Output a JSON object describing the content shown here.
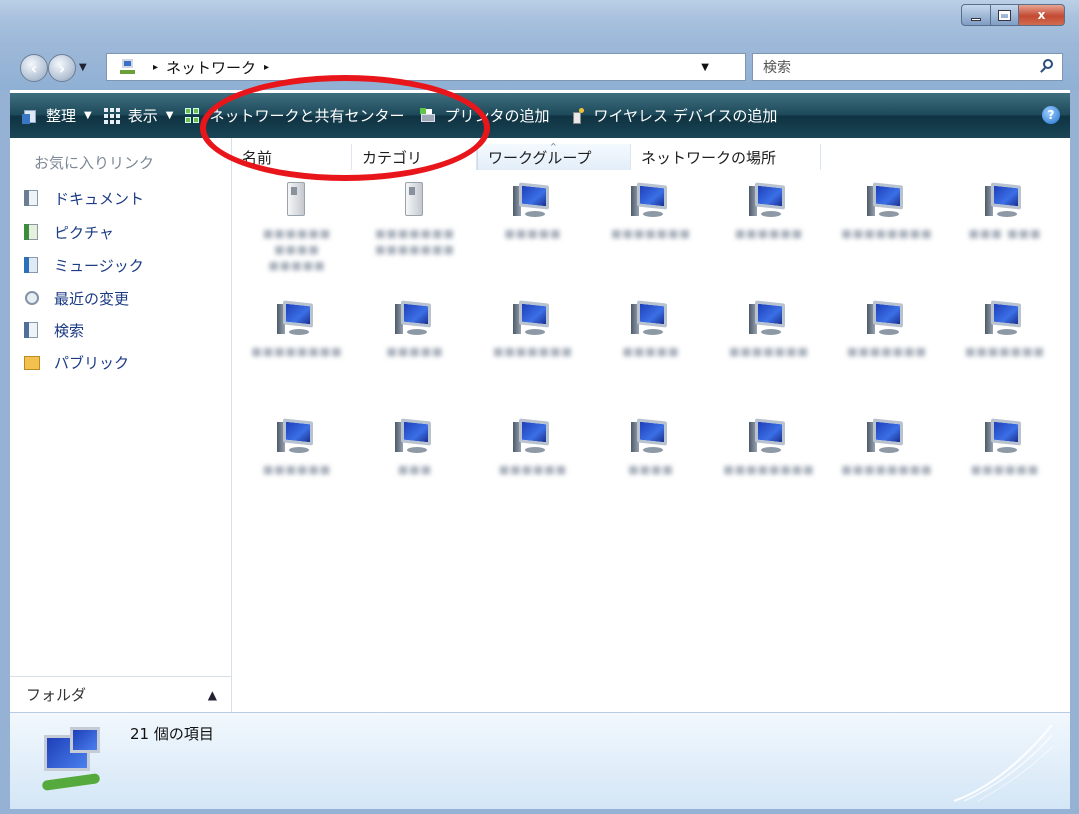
{
  "window": {
    "controls": {
      "minimize": "",
      "maximize": "",
      "close": "x"
    }
  },
  "address": {
    "path": [
      "ネットワーク"
    ],
    "separator": "▸",
    "search_placeholder": "検索"
  },
  "commandbar": {
    "items": [
      {
        "label": "整理",
        "icon": "organize-icon",
        "dropdown": true
      },
      {
        "label": "表示",
        "icon": "view-icon",
        "dropdown": true
      },
      {
        "label": "ネットワークと共有センター",
        "icon": "network-sharing-center-icon",
        "dropdown": false
      },
      {
        "label": "プリンタの追加",
        "icon": "printer-icon",
        "dropdown": false
      },
      {
        "label": "ワイヤレス デバイスの追加",
        "icon": "wireless-device-icon",
        "dropdown": false
      }
    ],
    "help": "?"
  },
  "navpane": {
    "favorites_title": "お気に入りリンク",
    "links": [
      {
        "label": "ドキュメント",
        "icon": "documents-icon"
      },
      {
        "label": "ピクチャ",
        "icon": "pictures-icon"
      },
      {
        "label": "ミュージック",
        "icon": "music-icon"
      },
      {
        "label": "最近の変更",
        "icon": "recent-changes-icon"
      },
      {
        "label": "検索",
        "icon": "searches-icon"
      },
      {
        "label": "パブリック",
        "icon": "public-folder-icon"
      }
    ],
    "folders_label": "フォルダ"
  },
  "content": {
    "columns": [
      "名前",
      "カテゴリ",
      "ワークグループ",
      "ネットワークの場所"
    ],
    "sorted_column": "ワークグループ",
    "items": [
      {
        "type": "server",
        "label": "■■■■■■ ■■■■ ■■■■■"
      },
      {
        "type": "server",
        "label": "■■■■■■■ ■■■■■■■"
      },
      {
        "type": "computer",
        "label": "■■■■■"
      },
      {
        "type": "computer",
        "label": "■■■■■■■"
      },
      {
        "type": "computer",
        "label": "■■■■■■"
      },
      {
        "type": "computer",
        "label": "■■■■■■■■"
      },
      {
        "type": "computer",
        "label": "■■■ ■■■"
      },
      {
        "type": "computer",
        "label": "■■■■■■■■"
      },
      {
        "type": "computer",
        "label": "■■■■■"
      },
      {
        "type": "computer",
        "label": "■■■■■■■"
      },
      {
        "type": "computer",
        "label": "■■■■■"
      },
      {
        "type": "computer",
        "label": "■■■■■■■"
      },
      {
        "type": "computer",
        "label": "■■■■■■■"
      },
      {
        "type": "computer",
        "label": "■■■■■■■"
      },
      {
        "type": "computer",
        "label": "■■■■■■"
      },
      {
        "type": "computer",
        "label": "■■■"
      },
      {
        "type": "computer",
        "label": "■■■■■■"
      },
      {
        "type": "computer",
        "label": "■■■■"
      },
      {
        "type": "computer",
        "label": "■■■■■■■■"
      },
      {
        "type": "computer",
        "label": "■■■■■■■■"
      },
      {
        "type": "computer",
        "label": "■■■■■■"
      }
    ]
  },
  "details": {
    "item_count": "21 個の項目"
  },
  "colors": {
    "annotation": "#e8161b",
    "commandbar": "#1e4a5a",
    "link": "#1c3b85"
  }
}
